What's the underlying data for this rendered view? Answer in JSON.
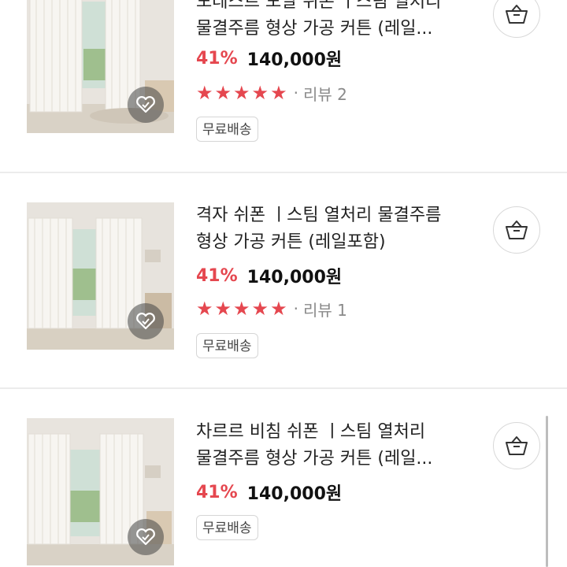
{
  "products": [
    {
      "title_line1": "모데스트 모달 쉬폰 ㅣ스팀 열처리",
      "title_line2": "물결주름 형상 가공 커튼 (레일...",
      "discount": "41%",
      "price": "140,000원",
      "rating_stars": 5,
      "review_dot": "·",
      "review_text": "리뷰 2",
      "badge": "무료배송"
    },
    {
      "title_line1": "격자 쉬폰 ㅣ스팀 열처리 물결주름",
      "title_line2": "형상 가공 커튼 (레일포함)",
      "discount": "41%",
      "price": "140,000원",
      "rating_stars": 5,
      "review_dot": "·",
      "review_text": "리뷰 1",
      "badge": "무료배송"
    },
    {
      "title_line1": "차르르 비침 쉬폰 ㅣ스팀 열처리",
      "title_line2": "물결주름 형상 가공 커튼 (레일...",
      "discount": "41%",
      "price": "140,000원",
      "badge": "무료배송"
    }
  ],
  "icons": {
    "cart": "shopping-bag-icon",
    "wish": "heart-icon",
    "star": "star-icon"
  },
  "colors": {
    "accent": "#e5474f",
    "text": "#222222",
    "muted": "#8a8a8a"
  }
}
